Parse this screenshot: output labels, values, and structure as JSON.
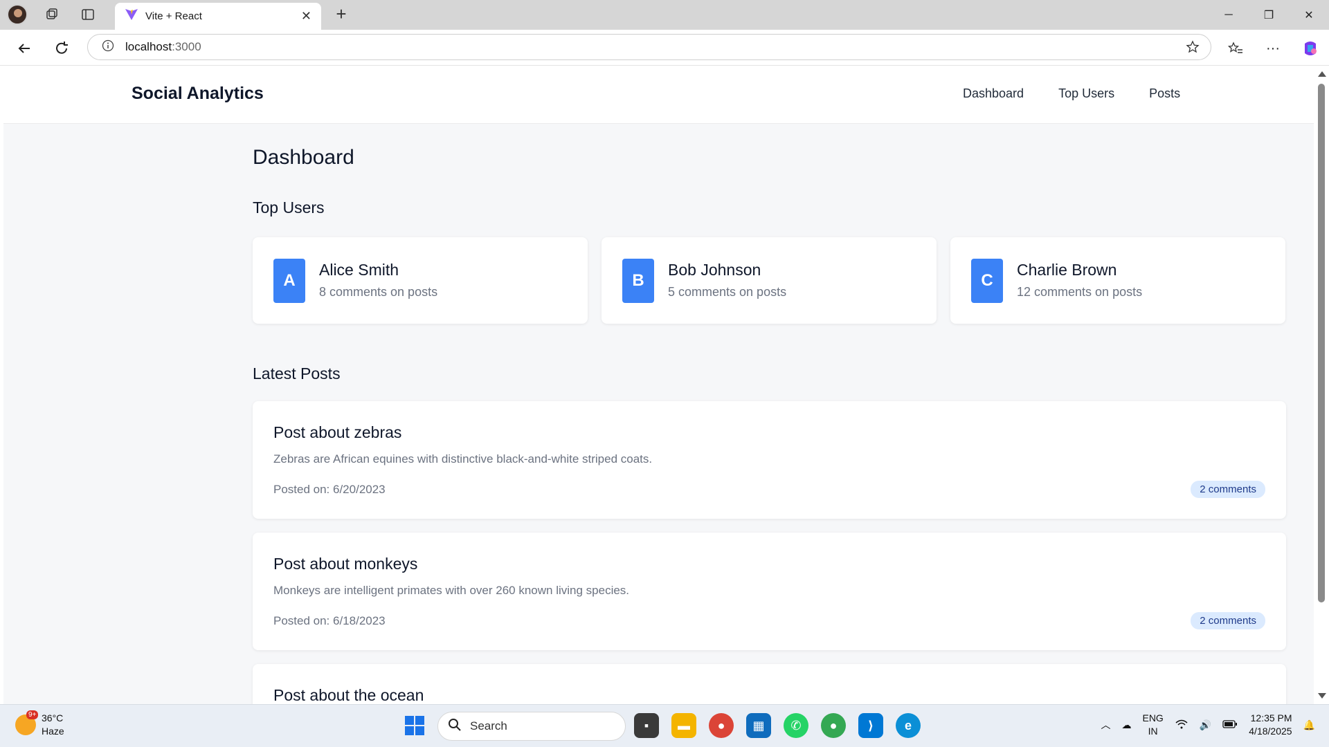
{
  "browser": {
    "tab_title": "Vite + React",
    "address_host": "localhost",
    "address_port": ":3000"
  },
  "app": {
    "brand": "Social Analytics",
    "nav": [
      "Dashboard",
      "Top Users",
      "Posts"
    ]
  },
  "page": {
    "title": "Dashboard",
    "top_users_heading": "Top Users",
    "latest_posts_heading": "Latest Posts",
    "users": [
      {
        "initial": "A",
        "name": "Alice Smith",
        "meta": "8 comments on posts"
      },
      {
        "initial": "B",
        "name": "Bob Johnson",
        "meta": "5 comments on posts"
      },
      {
        "initial": "C",
        "name": "Charlie Brown",
        "meta": "12 comments on posts"
      }
    ],
    "posts": [
      {
        "title": "Post about zebras",
        "body": "Zebras are African equines with distinctive black-and-white striped coats.",
        "date": "Posted on: 6/20/2023",
        "comments": "2 comments"
      },
      {
        "title": "Post about monkeys",
        "body": "Monkeys are intelligent primates with over 260 known living species.",
        "date": "Posted on: 6/18/2023",
        "comments": "2 comments"
      },
      {
        "title": "Post about the ocean"
      }
    ]
  },
  "taskbar": {
    "temperature": "36°C",
    "condition": "Haze",
    "weather_badge": "9+",
    "search_placeholder": "Search",
    "lang_1": "ENG",
    "lang_2": "IN",
    "time": "12:35 PM",
    "date": "4/18/2025"
  },
  "colors": {
    "accent": "#3b82f6",
    "badge_bg": "#dbeafe",
    "badge_text": "#1e3a8a"
  }
}
